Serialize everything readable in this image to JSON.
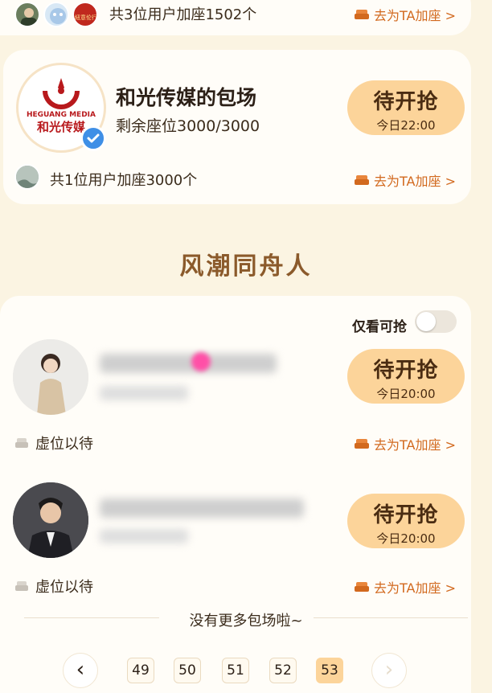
{
  "top_row": {
    "users_text": "共3位用户加座1502个",
    "go_label": "去为TA加座 >",
    "avatar_badge_text": "紐意伦行"
  },
  "heguang": {
    "title": "和光传媒的包场",
    "seats": "剩余座位3000/3000",
    "logo_text_en": "HEGUANG MEDIA",
    "logo_text_cn": "和光传媒",
    "button_main": "待开抢",
    "button_time": "今日22:00",
    "users_text": "共1位用户加座3000个",
    "go_label": "去为TA加座 >"
  },
  "section_title": "风潮同舟人",
  "filter": {
    "label": "仅看可抢",
    "enabled": false
  },
  "entries": [
    {
      "button_main": "待开抢",
      "button_time": "今日20:00",
      "virtual_label": "虚位以待",
      "go_label": "去为TA加座 >"
    },
    {
      "button_main": "待开抢",
      "button_time": "今日20:00",
      "virtual_label": "虚位以待",
      "go_label": "去为TA加座 >"
    }
  ],
  "end_text": "没有更多包场啦~",
  "pagination": {
    "pages": [
      "49",
      "50",
      "51",
      "52",
      "53"
    ],
    "current": "53",
    "prev_glyph": "‹",
    "next_glyph": "›"
  },
  "colors": {
    "background": "#fbf4e2",
    "accent_button": "#fcd49a",
    "link": "#d2691e",
    "section_title": "#8b5a2b",
    "verified": "#3f8fe6"
  }
}
